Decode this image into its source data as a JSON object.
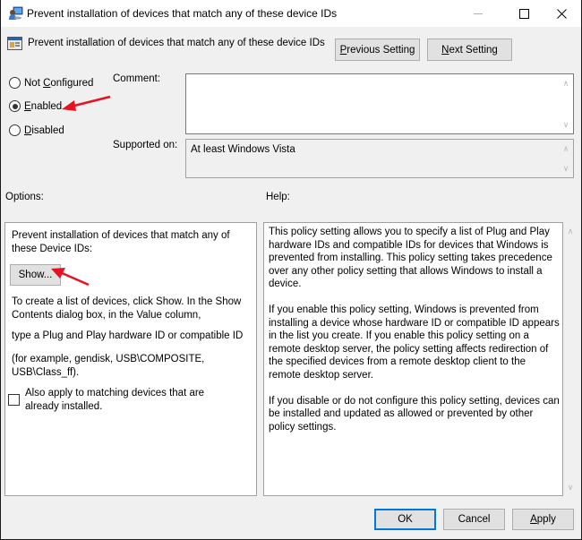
{
  "window": {
    "title": "Prevent installation of devices that match any of these device IDs",
    "controls": {
      "minimize": "minimize",
      "maximize": "maximize",
      "close": "close"
    }
  },
  "header": {
    "title": "Prevent installation of devices that match any of these device IDs",
    "previous_label_u": "P",
    "previous_label_rest": "revious Setting",
    "next_label_u": "N",
    "next_label_rest": "ext Setting"
  },
  "state": {
    "options": [
      {
        "pre": "Not ",
        "u": "C",
        "rest": "onfigured",
        "checked": false
      },
      {
        "pre": "",
        "u": "E",
        "rest": "nabled",
        "checked": true
      },
      {
        "pre": "",
        "u": "D",
        "rest": "isabled",
        "checked": false
      }
    ]
  },
  "comment": {
    "label": "Comment:",
    "value": ""
  },
  "supported": {
    "label": "Supported on:",
    "value": "At least Windows Vista"
  },
  "options_section": {
    "label": "Options:",
    "description": "Prevent installation of devices that match any of these Device IDs:",
    "show_button": "Show...",
    "instructions_1": "To create a list of devices, click Show. In the Show Contents dialog box, in the Value column,",
    "instructions_2": "type a Plug and Play hardware ID or compatible ID",
    "instructions_3": "(for example, gendisk, USB\\COMPOSITE, USB\\Class_ff).",
    "checkbox_label": "Also apply to matching devices that are already installed.",
    "checkbox_checked": false
  },
  "help_section": {
    "label": "Help:",
    "paragraphs": [
      "This policy setting allows you to specify a list of Plug and Play hardware IDs and compatible IDs for devices that Windows is prevented from installing. This policy setting takes precedence over any other policy setting that allows Windows to install a device.",
      "If you enable this policy setting, Windows is prevented from installing a device whose hardware ID or compatible ID appears in the list you create. If you enable this policy setting on a remote desktop server, the policy setting affects redirection of the specified devices from a remote desktop client to the remote desktop server.",
      "If you disable or do not configure this policy setting, devices can be installed and updated as allowed or prevented by other policy settings."
    ]
  },
  "footer": {
    "ok": "OK",
    "cancel": "Cancel",
    "apply_u": "A",
    "apply_rest": "pply"
  },
  "annotations": {
    "arrow_color": "#e81123"
  }
}
